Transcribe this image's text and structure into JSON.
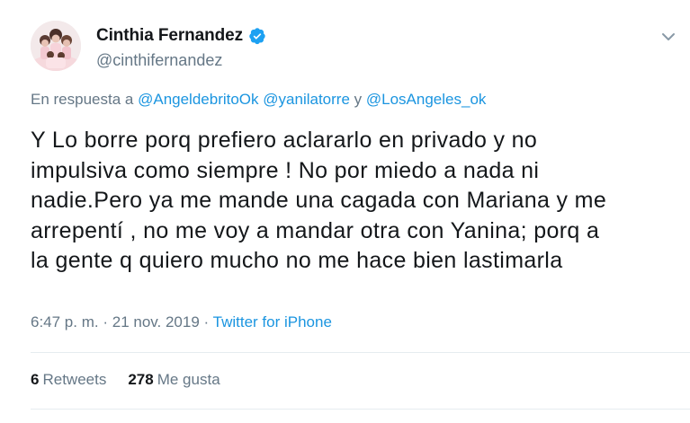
{
  "author": {
    "display_name": "Cinthia Fernandez",
    "handle": "@cinthifernandez",
    "verified": true,
    "avatar_icon": "profile-photo"
  },
  "reply": {
    "prefix": "En respuesta a",
    "mention_1": "@AngeldebritoOk",
    "mention_2": "@yanilatorre",
    "conjunction": "y",
    "mention_3": "@LosAngeles_ok"
  },
  "tweet": {
    "lines": [
      "Y Lo borre porq prefiero aclararlo en privado y no",
      "impulsiva como siempre ! No por miedo a nada ni",
      "nadie.Pero ya me mande una cagada con Mariana y me",
      "arrepentí , no me voy a mandar otra con Yanina; porq a",
      "la gente q quiero mucho no me hace bien lastimarla"
    ]
  },
  "meta": {
    "time": "6:47 p. m.",
    "separator": "·",
    "date": "21 nov. 2019",
    "source": "Twitter for iPhone"
  },
  "stats": {
    "retweets_count": "6",
    "retweets_label": "Retweets",
    "likes_count": "278",
    "likes_label": "Me gusta"
  },
  "colors": {
    "link": "#1b95e0",
    "secondary_text": "#657786",
    "primary_text": "#14171a",
    "verified_badge": "#1da1f2",
    "divider": "#e6ecf0"
  },
  "icons": {
    "verified": "verified-badge-icon",
    "menu": "chevron-down-icon"
  }
}
